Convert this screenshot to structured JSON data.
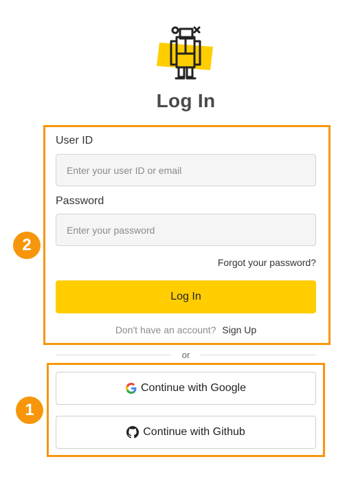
{
  "page": {
    "title": "Log In"
  },
  "form": {
    "user_id_label": "User ID",
    "user_id_placeholder": "Enter your user ID or email",
    "user_id_value": "",
    "password_label": "Password",
    "password_placeholder": "Enter your password",
    "password_value": "",
    "forgot_password": "Forgot your password?",
    "login_button": "Log In",
    "no_account_text": "Don't have an account?",
    "signup_link": "Sign Up"
  },
  "divider": {
    "text": "or"
  },
  "social": {
    "google_label": "Continue with Google",
    "github_label": "Continue with Github"
  },
  "callouts": [
    {
      "number": "2"
    },
    {
      "number": "1"
    }
  ],
  "colors": {
    "accent": "#ffcd00",
    "callout": "#f7960b",
    "input_bg": "#f5f5f5"
  },
  "icons": [
    "robot-logo-icon",
    "google-icon",
    "github-icon"
  ]
}
